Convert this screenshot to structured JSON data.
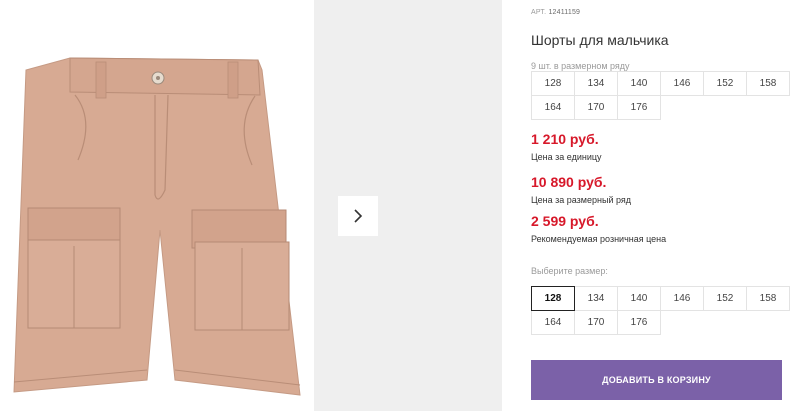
{
  "product": {
    "article_label": "АРТ.",
    "article_number": "12411159",
    "title": "Шорты для мальчика",
    "pcs_in_range": "9 шт. в размерном ряду",
    "range_sizes": [
      "128",
      "134",
      "140",
      "146",
      "152",
      "158",
      "164",
      "170",
      "176"
    ]
  },
  "prices": {
    "unit_price": "1 210 руб.",
    "unit_label": "Цена за единицу",
    "range_price": "10 890 руб.",
    "range_label": "Цена за размерный ряд",
    "retail_price": "2 599 руб.",
    "retail_label": "Рекомендуемая розничная цена",
    "accent_color": "#d7182a"
  },
  "size_select": {
    "label": "Выберите размер:",
    "sizes": [
      "128",
      "134",
      "140",
      "146",
      "152",
      "158",
      "164",
      "170",
      "176"
    ],
    "selected": "128"
  },
  "cart": {
    "button_label": "ДОБАВИТЬ В КОРЗИНУ",
    "button_color": "#7b61a8"
  },
  "gallery": {
    "next_icon": "chevron-right-icon",
    "product_image": "beige cargo shorts"
  }
}
